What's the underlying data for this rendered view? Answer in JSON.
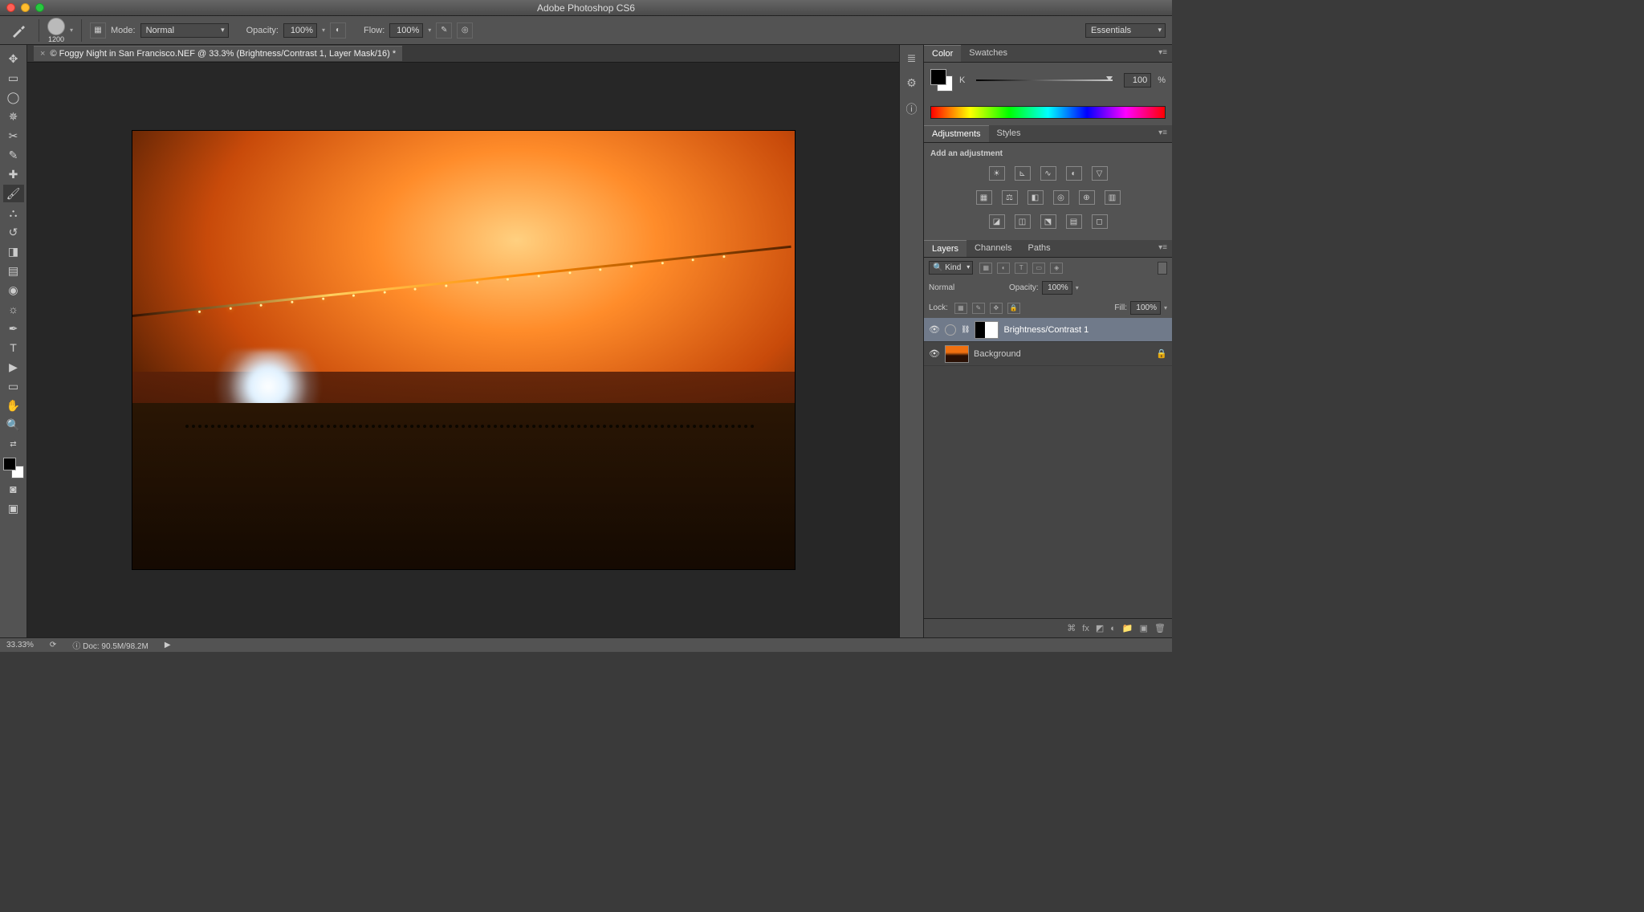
{
  "app_title": "Adobe Photoshop CS6",
  "options_bar": {
    "brush_size": "1200",
    "mode_label": "Mode:",
    "mode_value": "Normal",
    "opacity_label": "Opacity:",
    "opacity_value": "100%",
    "flow_label": "Flow:",
    "flow_value": "100%",
    "workspace": "Essentials"
  },
  "tab": {
    "title": "© Foggy Night in San Francisco.NEF @ 33.3% (Brightness/Contrast 1, Layer Mask/16) *"
  },
  "color_panel": {
    "tab_color": "Color",
    "tab_swatches": "Swatches",
    "channel": "K",
    "value": "100",
    "pct": "%"
  },
  "adjustments_panel": {
    "tab_adjustments": "Adjustments",
    "tab_styles": "Styles",
    "heading": "Add an adjustment"
  },
  "layers_panel": {
    "tab_layers": "Layers",
    "tab_channels": "Channels",
    "tab_paths": "Paths",
    "filter_kind": "Kind",
    "blend_mode": "Normal",
    "opacity_label": "Opacity:",
    "opacity_value": "100%",
    "lock_label": "Lock:",
    "fill_label": "Fill:",
    "fill_value": "100%",
    "layers": [
      {
        "name": "Brightness/Contrast 1"
      },
      {
        "name": "Background"
      }
    ]
  },
  "status": {
    "zoom": "33.33%",
    "doc": "Doc: 90.5M/98.2M"
  }
}
